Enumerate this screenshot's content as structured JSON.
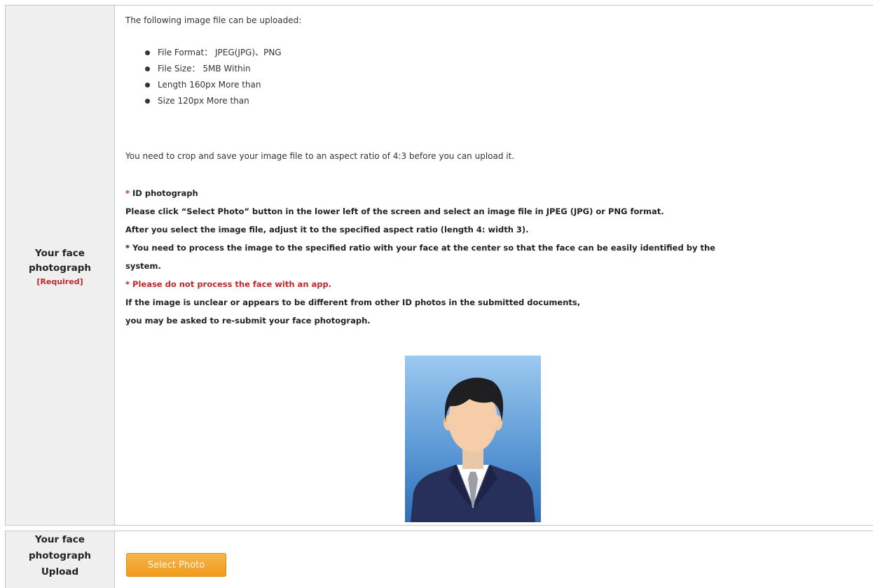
{
  "face_photo_section": {
    "label_line1": "Your face",
    "label_line2": "photograph",
    "required": "[Required]",
    "intro": "The following image file can be uploaded:",
    "requirements": [
      "File Format： JPEG(JPG)、PNG",
      "File Size： 5MB Within",
      "Length 160px More than",
      "Size 120px More than"
    ],
    "crop_note": "You need to crop and save your image file to an aspect ratio of 4:3 before you can upload it.",
    "id_heading_asterisk": "*",
    "id_heading": " ID photograph",
    "instruction_1": "Please click “Select Photo” button in the lower left of the screen and select an image file in JPEG (JPG) or PNG format.",
    "instruction_2": "After you select the image file, adjust it to the specified aspect ratio (length 4: width 3).",
    "instruction_3a": "* You need to process the image to the specified ratio with your face at the center so that the face can be easily identified by the",
    "instruction_3b": "system.",
    "warning": "* Please do not process the face with an app.",
    "instruction_4": "If the image is unclear or appears to be different from other ID photos in the submitted documents,",
    "instruction_5": "you may be asked to re-submit your face photograph."
  },
  "upload_section": {
    "label_line1": "Your face",
    "label_line2": "photograph",
    "label_line3": "Upload",
    "button_label": "Select Photo"
  },
  "colors": {
    "required_red": "#c0282d",
    "button_orange": "#f0a030",
    "label_bg": "#efefef"
  }
}
